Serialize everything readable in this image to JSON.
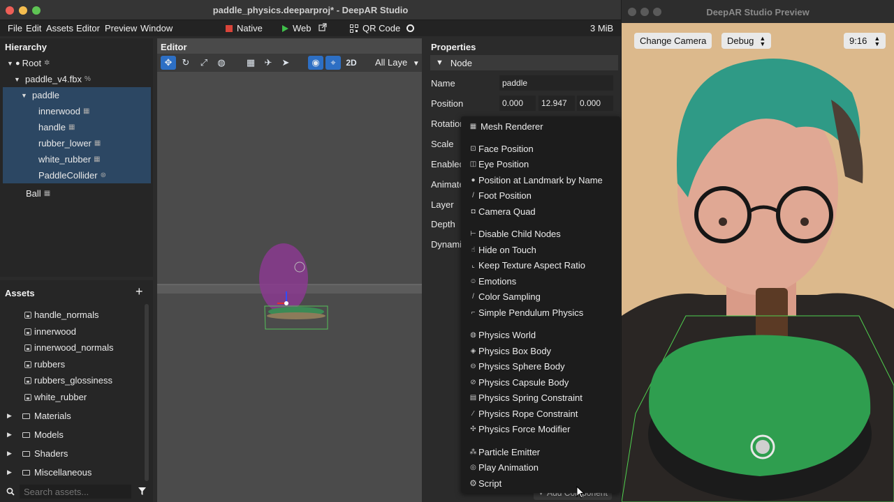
{
  "window": {
    "title": "paddle_physics.deeparproj* - DeepAR Studio"
  },
  "menu": {
    "items": [
      "File",
      "Edit",
      "Assets",
      "Editor",
      "Preview",
      "Window"
    ],
    "native_label": "Native",
    "web_label": "Web",
    "qr_label": "QR Code",
    "size_label": "3 MiB"
  },
  "hierarchy": {
    "title": "Hierarchy",
    "nodes": [
      "Root",
      "paddle_v4.fbx",
      "paddle",
      "innerwood",
      "handle",
      "rubber_lower",
      "white_rubber",
      "PaddleCollider",
      "Ball"
    ]
  },
  "assets": {
    "title": "Assets",
    "files": [
      "handle_normals",
      "innerwood",
      "innerwood_normals",
      "rubbers",
      "rubbers_glossiness",
      "white_rubber"
    ],
    "folders": [
      "Materials",
      "Models",
      "Shaders",
      "Miscellaneous"
    ],
    "search_placeholder": "Search assets..."
  },
  "editor": {
    "title": "Editor",
    "mode_label": "2D",
    "layers_label": "All Laye"
  },
  "properties": {
    "title": "Properties",
    "section": "Node",
    "labels": [
      "Name",
      "Position",
      "Rotatior",
      "Scale",
      "Enabled",
      "Animate",
      "Layer",
      "Depth",
      "Dynami"
    ],
    "name_value": "paddle",
    "position": [
      "0.000",
      "12.947",
      "0.000"
    ],
    "add_component_label": "Add Component"
  },
  "context_menu": {
    "items": [
      {
        "label": "Mesh Renderer",
        "icon": "grid-icon"
      },
      {
        "label": "Face Position",
        "icon": "face-icon"
      },
      {
        "label": "Eye Position",
        "icon": "eye-icon"
      },
      {
        "label": "Position at Landmark by Name",
        "icon": "pin-icon"
      },
      {
        "label": "Foot Position",
        "icon": "foot-icon"
      },
      {
        "label": "Camera Quad",
        "icon": "camera-icon"
      },
      {
        "label": "Disable Child Nodes",
        "icon": "tree-icon"
      },
      {
        "label": "Hide on Touch",
        "icon": "touch-icon"
      },
      {
        "label": "Keep Texture Aspect Ratio",
        "icon": "aspect-icon"
      },
      {
        "label": "Emotions",
        "icon": "emotion-icon"
      },
      {
        "label": "Color Sampling",
        "icon": "dropper-icon"
      },
      {
        "label": "Simple Pendulum Physics",
        "icon": "pendulum-icon"
      },
      {
        "label": "Physics World",
        "icon": "globe-icon"
      },
      {
        "label": "Physics Box Body",
        "icon": "box-icon"
      },
      {
        "label": "Physics Sphere Body",
        "icon": "sphere-icon"
      },
      {
        "label": "Physics Capsule Body",
        "icon": "capsule-icon"
      },
      {
        "label": "Physics Spring Constraint",
        "icon": "spring-icon"
      },
      {
        "label": "Physics Rope Constraint",
        "icon": "rope-icon"
      },
      {
        "label": "Physics Force Modifier",
        "icon": "force-icon"
      },
      {
        "label": "Particle Emitter",
        "icon": "particle-icon"
      },
      {
        "label": "Play Animation",
        "icon": "play-icon"
      },
      {
        "label": "Script",
        "icon": "gear-icon"
      }
    ]
  },
  "preview": {
    "title": "DeepAR Studio Preview",
    "change_camera_label": "Change Camera",
    "debug_label": "Debug",
    "ratio_label": "9:16"
  },
  "colors": {
    "selection": "#2c4763",
    "accent_blue": "#2d6fc4",
    "native_red": "#d9443a",
    "web_green": "#3fbf4a",
    "paddle_green": "#2f9e4f"
  }
}
